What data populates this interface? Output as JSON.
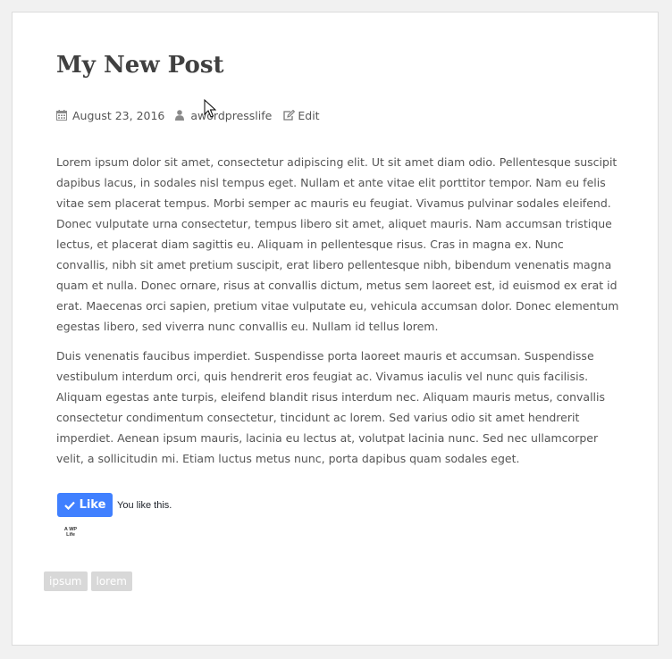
{
  "post": {
    "title": "My New Post",
    "meta": {
      "date": "August 23, 2016",
      "author": "awplife",
      "author_visible_prefix": "aw",
      "author_visible_suffix": "pressli",
      "edit_label": "Edit"
    },
    "paragraphs": [
      "Lorem ipsum dolor sit amet, consectetur adipiscing elit. Ut sit amet diam odio. Pellentesque suscipit dapibus lacus, in sodales nisl tempus eget. Nullam et ante vitae elit porttitor tempor. Nam eu felis vitae sem placerat tempus. Morbi semper ac mauris eu feugiat. Vivamus pulvinar sodales eleifend. Donec vulputate urna consectetur, tempus libero sit amet, aliquet mauris. Nam accumsan tristique lectus, et placerat diam sagittis eu. Aliquam in pellentesque risus. Cras in magna ex. Nunc convallis, nibh sit amet pretium suscipit, erat libero pellentesque nibh, bibendum venenatis magna quam et nulla. Donec ornare, risus at convallis dictum, metus sem laoreet est, id euismod ex erat id erat. Maecenas orci sapien, pretium vitae vulputate eu, vehicula accumsan dolor. Donec elementum egestas libero, sed viverra nunc convallis eu. Nullam id tellus lorem.",
      "Duis venenatis faucibus imperdiet. Suspendisse porta laoreet mauris et accumsan. Suspendisse vestibulum interdum orci, quis hendrerit eros feugiat ac. Vivamus iaculis vel nunc quis facilisis. Aliquam egestas ante turpis, eleifend blandit risus interdum nec. Aliquam mauris metus, convallis consectetur condimentum consectetur, tincidunt ac lorem. Sed varius odio sit amet hendrerit imperdiet. Aenean ipsum mauris, lacinia eu lectus at, volutpat lacinia nunc. Sed nec ullamcorper velit, a sollicitudin mi. Etiam luctus metus nunc, porta dapibus quam sodales eget."
    ],
    "like_widget": {
      "button_label": "Like",
      "status_text": "You like this.",
      "avatar_text_line1": "A WP",
      "avatar_text_line2": "Life"
    },
    "tags": [
      "ipsum",
      "lorem"
    ]
  },
  "colors": {
    "page_bg": "#f1f1f1",
    "card_bg": "#ffffff",
    "text": "#555555",
    "title": "#404040",
    "like_blue": "#4080ff",
    "tag_bg": "#d8d8d8"
  },
  "icons": {
    "date": "calendar-icon",
    "author": "user-icon",
    "edit": "edit-icon",
    "like": "check-icon",
    "cursor": "mouse-cursor-icon"
  }
}
